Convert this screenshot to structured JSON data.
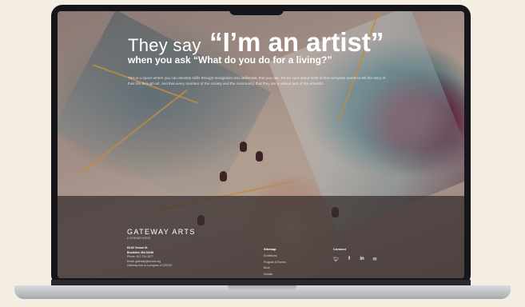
{
  "hero": {
    "title_small": "They say",
    "title_big": "“I’m an artist”",
    "subtitle": "when you ask “What do you do for a living?”",
    "paragraph": "This is a space where you can develop skills through recognition and deliberate, that you can. So we care about most is that everyone needs to tell the story of their life through art, and that every member of the society and the community, that they are a valued part of the artworld."
  },
  "footer": {
    "brand": "GATEWAY ARTS",
    "brand_sub": "A GATEWAY EVENT",
    "address_line1": "60-62 Vernon St.",
    "address_line2": "Brookline, MA 02446",
    "phone": "Phone: 617-734-1577",
    "email": "Email: gateway@crtcinc.org",
    "org_note": "Gateway Arts is a program of CRCSC",
    "sitemap_title": "Sitemap",
    "sitemap_items": [
      "Exhibitions",
      "Program & Events",
      "Book",
      "Donate"
    ],
    "connect_title": "Connect",
    "social_icons": [
      "twitter-icon",
      "facebook-icon",
      "linkedin-icon",
      "email-icon"
    ]
  }
}
